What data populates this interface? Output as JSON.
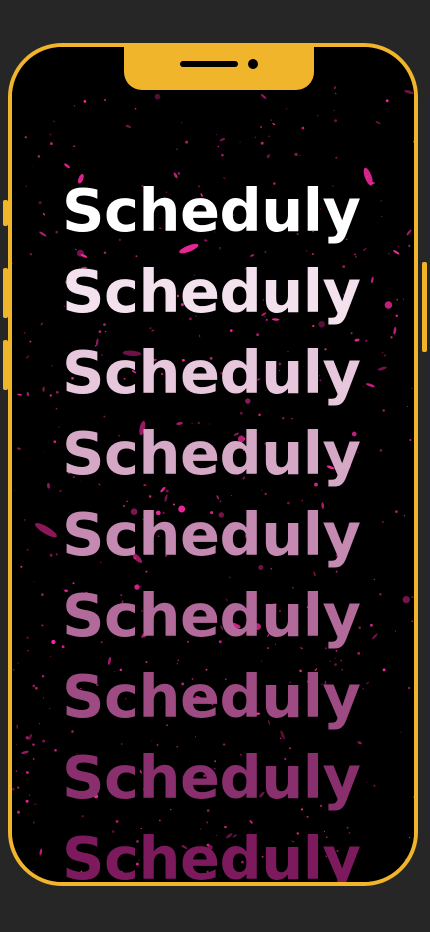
{
  "app_name": "Scheduly",
  "colors": {
    "background": "#262626",
    "frame": "#f0b52a",
    "screen": "#000000",
    "splatter": "#ff2aa3"
  },
  "words": [
    {
      "text": "Scheduly",
      "color": "#ffffff"
    },
    {
      "text": "Scheduly",
      "color": "#f3e2ee"
    },
    {
      "text": "Scheduly",
      "color": "#e7c7dc"
    },
    {
      "text": "Scheduly",
      "color": "#d5a8c6"
    },
    {
      "text": "Scheduly",
      "color": "#c48ab1"
    },
    {
      "text": "Scheduly",
      "color": "#b16a99"
    },
    {
      "text": "Scheduly",
      "color": "#9d4b82"
    },
    {
      "text": "Scheduly",
      "color": "#8a2f6e"
    },
    {
      "text": "Scheduly",
      "color": "#7c1a5d"
    }
  ]
}
